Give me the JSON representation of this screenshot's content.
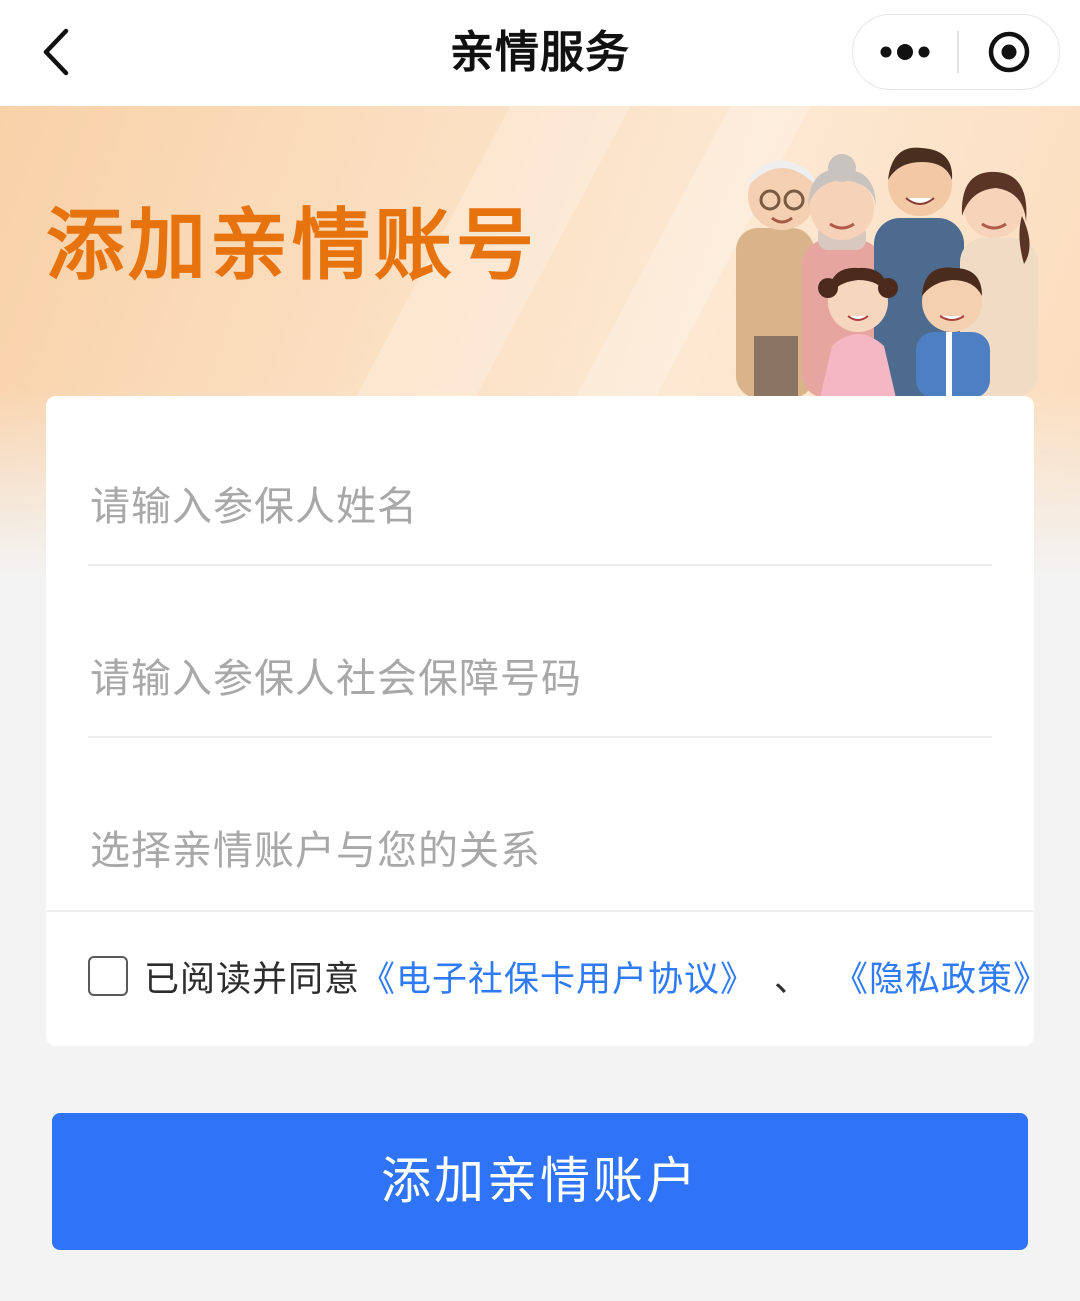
{
  "navbar": {
    "title": "亲情服务",
    "back_icon": "chevron-left-icon",
    "more_icon": "more-dots-icon",
    "close_icon": "target-close-icon"
  },
  "banner": {
    "title": "添加亲情账号",
    "illustration": "family-illustration",
    "title_color": "#e7730f"
  },
  "form": {
    "name_placeholder": "请输入参保人姓名",
    "id_placeholder": "请输入参保人社会保障号码",
    "relation_placeholder": "选择亲情账户与您的关系"
  },
  "agreement": {
    "checked": false,
    "prefix": "已阅读并同意",
    "link1": "《电子社保卡用户协议》",
    "separator": "、",
    "link2": "《隐私政策》",
    "link_color": "#2f7bf5"
  },
  "submit": {
    "label": "添加亲情账户",
    "color": "#2f74f6"
  }
}
